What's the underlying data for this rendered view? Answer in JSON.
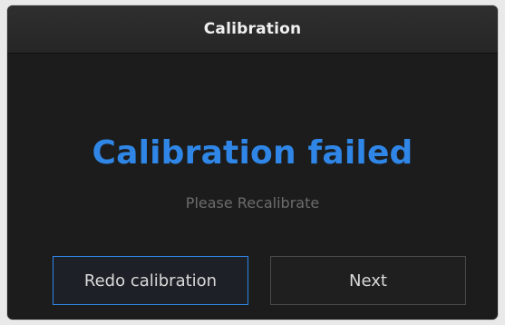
{
  "dialog": {
    "title": "Calibration",
    "headline": "Calibration failed",
    "message": "Please Recalibrate",
    "buttons": {
      "redo_label": "Redo calibration",
      "next_label": "Next"
    }
  },
  "colors": {
    "accent": "#2f86e6",
    "background": "#1c1c1c",
    "titlebar": "#2a2a2a",
    "muted_text": "#6c6c6c"
  }
}
